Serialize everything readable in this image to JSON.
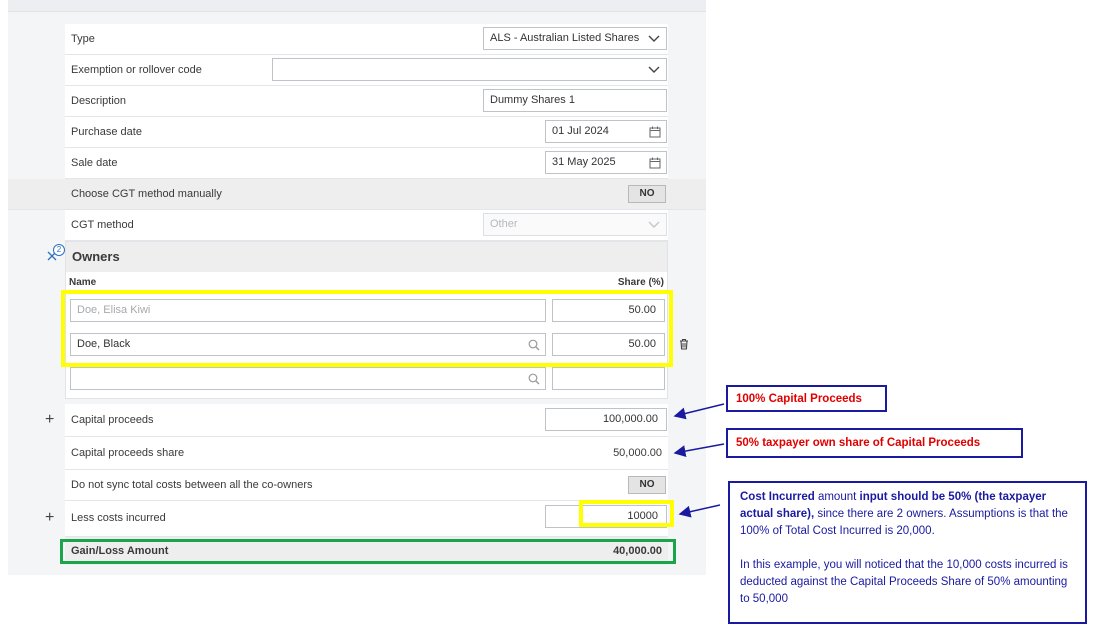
{
  "form": {
    "type": {
      "label": "Type",
      "value": "ALS - Australian Listed Shares"
    },
    "exemption": {
      "label": "Exemption or rollover code",
      "value": ""
    },
    "description": {
      "label": "Description",
      "value": "Dummy Shares 1"
    },
    "purchase_date": {
      "label": "Purchase date",
      "value": "01 Jul 2024"
    },
    "sale_date": {
      "label": "Sale date",
      "value": "31 May 2025"
    },
    "cgt_manual": {
      "label": "Choose CGT method manually",
      "toggle": "NO"
    },
    "cgt_method": {
      "label": "CGT method",
      "placeholder": "Other"
    },
    "owners": {
      "badge": "2",
      "title": "Owners",
      "col_name": "Name",
      "col_share": "Share (%)",
      "rows": [
        {
          "name": "Doe, Elisa Kiwi",
          "share": "50.00"
        },
        {
          "name": "Doe, Black",
          "share": "50.00"
        },
        {
          "name": "",
          "share": ""
        }
      ]
    },
    "capital_proceeds": {
      "label": "Capital proceeds",
      "value": "100,000.00"
    },
    "capital_proceeds_share": {
      "label": "Capital proceeds share",
      "value": "50,000.00"
    },
    "no_sync": {
      "label": "Do not sync total costs between all the co-owners",
      "toggle": "NO"
    },
    "costs": {
      "label": "Less costs incurred",
      "value": "10000"
    },
    "gain_loss": {
      "label": "Gain/Loss Amount",
      "value": "40,000.00"
    }
  },
  "annotations": {
    "note1": "100% Capital Proceeds",
    "note2": "50% taxpayer own share of Capital Proceeds",
    "note3": {
      "bold1": "Cost Incurred",
      "t1": " amount ",
      "bold2": "input should be 50% (the taxpayer actual share),",
      "t2": " since there are 2 owners. Assumptions is that the 100% of Total Cost Incurred is 20,000.",
      "p2": "In this example, you will noticed that the 10,000 costs incurred is deducted against the Capital Proceeds Share of 50% amounting to 50,000"
    }
  },
  "colors": {
    "highlight_yellow": "#ffff00",
    "highlight_green": "#1aa54a",
    "note_border": "#1a1aa0",
    "note_red": "#e00000"
  }
}
